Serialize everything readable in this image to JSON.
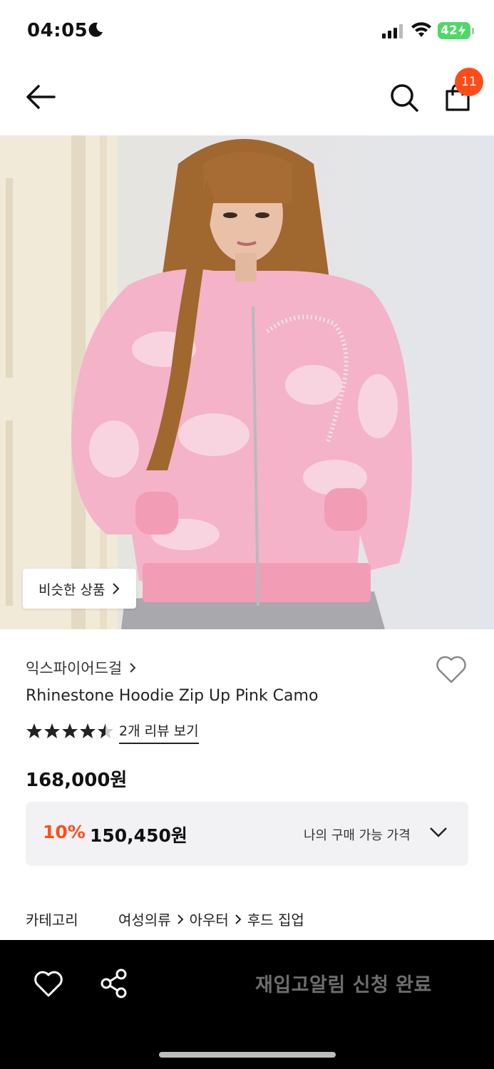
{
  "status_bar": {
    "time": "04:05",
    "battery": "42"
  },
  "header": {
    "cart_count": "11"
  },
  "hero": {
    "similar_label": "비슷한 상품"
  },
  "product": {
    "brand": "익스파이어드걸",
    "name": "Rhinestone Hoodie Zip Up Pink Camo",
    "rating": 4.5,
    "review_link": "2개 리뷰 보기",
    "price": "168,000원"
  },
  "price_box": {
    "discount": "10%",
    "sale_price": "150,450원",
    "my_price_label": "나의 구매 가능 가격"
  },
  "category": {
    "label": "카테고리",
    "path": [
      "여성의류",
      "아우터",
      "후드 집업"
    ]
  },
  "bottom_bar": {
    "restock_label": "재입고알림 신청 완료"
  },
  "colors": {
    "accent": "#ff4d1a",
    "hoodie_pink": "#f4b3c8",
    "bottom_bar": "#000000"
  }
}
